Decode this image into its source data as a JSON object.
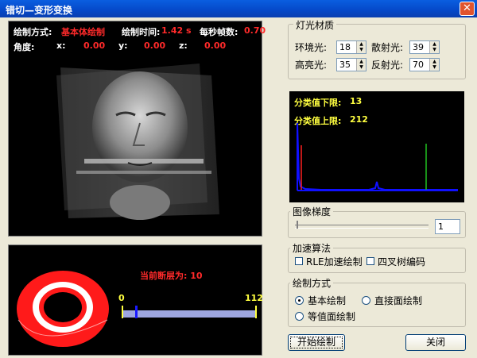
{
  "window": {
    "title": "错切—变形变换",
    "close_glyph": "✕"
  },
  "render": {
    "mode_label": "绘制方式:",
    "mode_value": "基本体绘制",
    "time_label": "绘制时间:",
    "time_value": "1.42 s",
    "fps_label": "每秒帧数:",
    "fps_value": "0.70",
    "angle_label": "角度:",
    "x_label": "x:",
    "x_value": "0.00",
    "y_label": "y:",
    "y_value": "0.00",
    "z_label": "z:",
    "z_value": "0.00"
  },
  "slice": {
    "current_label": "当前断层为: 10",
    "scale_min": "0",
    "scale_max": "112",
    "current_fraction": 0.09
  },
  "material": {
    "title": "灯光材质",
    "ambient_label": "环境光:",
    "ambient_value": "18",
    "diffuse_label": "散射光:",
    "diffuse_value": "39",
    "specular_label": "高亮光:",
    "specular_value": "35",
    "reflect_label": "反射光:",
    "reflect_value": "70"
  },
  "histogram": {
    "lower_label": "分类值下限:",
    "lower_value": "13",
    "upper_label": "分类值上限:",
    "upper_value": "212"
  },
  "gradient": {
    "title": "图像梯度",
    "value": "1"
  },
  "accel": {
    "title": "加速算法",
    "rle_label": "RLE加速绘制",
    "octree_label": "四叉树编码"
  },
  "draw_mode": {
    "title": "绘制方式",
    "basic_label": "基本绘制",
    "direct_label": "直接面绘制",
    "iso_label": "等值面绘制",
    "selected": "basic"
  },
  "buttons": {
    "start": "开始绘制",
    "close": "关闭"
  },
  "colors": {
    "titlebar": "#0a4fd0",
    "black_panel": "#000000",
    "red_text": "#ff2a2a",
    "yellow_text": "#ffff40",
    "hist_line": "#1010ff"
  }
}
